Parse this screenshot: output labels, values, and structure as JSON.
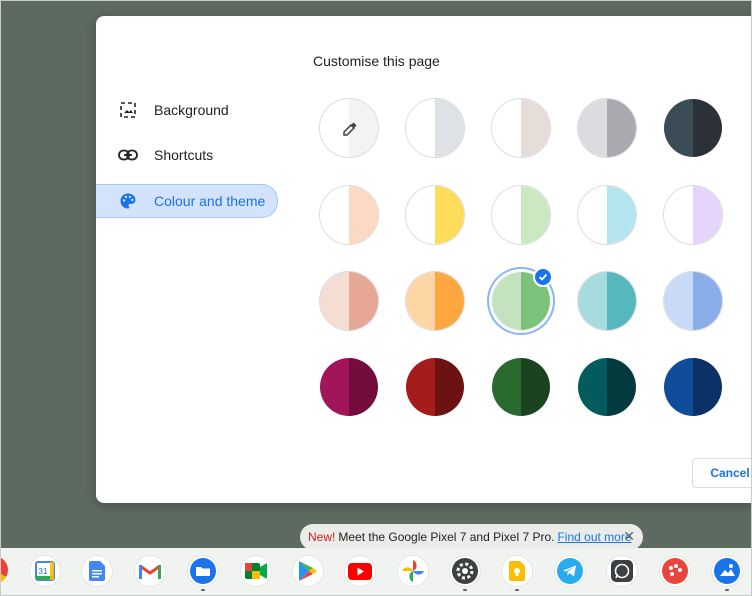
{
  "dialog": {
    "title": "Customise this page",
    "cancel_label": "Cancel"
  },
  "sidebar": {
    "items": [
      {
        "label": "Background",
        "icon": "image-icon"
      },
      {
        "label": "Shortcuts",
        "icon": "link-icon"
      },
      {
        "label": "Colour and theme",
        "icon": "palette-icon",
        "active": true
      }
    ]
  },
  "swatches": {
    "selected": "green",
    "rows": [
      [
        {
          "name": "custom",
          "left": "#ffffff",
          "right": "#f1f3f4",
          "icon": "eyedropper-icon"
        },
        {
          "name": "default-light",
          "left": "#ffffff",
          "right": "#dee1e6"
        },
        {
          "name": "warm-grey",
          "left": "#ffffff",
          "right": "#e6dcd8"
        },
        {
          "name": "cool-grey",
          "left": "#dadce0",
          "right": "#a8aab0"
        },
        {
          "name": "slate",
          "left": "#3c4c56",
          "right": "#2a3238"
        }
      ],
      [
        {
          "name": "peach-light",
          "left": "#ffffff",
          "right": "#fcd9c2"
        },
        {
          "name": "yellow",
          "left": "#ffffff",
          "right": "#fddd5a"
        },
        {
          "name": "mint-light",
          "left": "#ffffff",
          "right": "#cce8c2"
        },
        {
          "name": "aqua-light",
          "left": "#ffffff",
          "right": "#b3e4ef"
        },
        {
          "name": "lavender-light",
          "left": "#ffffff",
          "right": "#e5d4fb"
        }
      ],
      [
        {
          "name": "apricot",
          "left": "#f6ddd4",
          "right": "#e6a796"
        },
        {
          "name": "orange",
          "left": "#fed6a6",
          "right": "#fda740"
        },
        {
          "name": "green",
          "left": "#c4e2c0",
          "right": "#7cc27a"
        },
        {
          "name": "teal",
          "left": "#a7dcdf",
          "right": "#56b7bf"
        },
        {
          "name": "blue",
          "left": "#c9daf8",
          "right": "#8aaeea"
        }
      ],
      [
        {
          "name": "plum",
          "left": "#a3155a",
          "right": "#720d3d"
        },
        {
          "name": "crimson",
          "left": "#a51c1c",
          "right": "#6d1212"
        },
        {
          "name": "forest",
          "left": "#2a6a2f",
          "right": "#1b4320"
        },
        {
          "name": "deep-teal",
          "left": "#045b5e",
          "right": "#043a3e"
        },
        {
          "name": "navy",
          "left": "#0f4d9a",
          "right": "#0a3266"
        }
      ]
    ]
  },
  "notification": {
    "new_label": "New!",
    "text": "Meet the Google Pixel 7 and Pixel 7 Pro.",
    "link_label": "Find out more"
  },
  "shelf": {
    "calendar_number": "31",
    "apps": [
      "chrome",
      "calendar",
      "docs",
      "gmail",
      "files",
      "meet",
      "play-store",
      "youtube",
      "photos",
      "settings",
      "keep",
      "telegram",
      "whatsapp",
      "paint",
      "gallery"
    ]
  }
}
